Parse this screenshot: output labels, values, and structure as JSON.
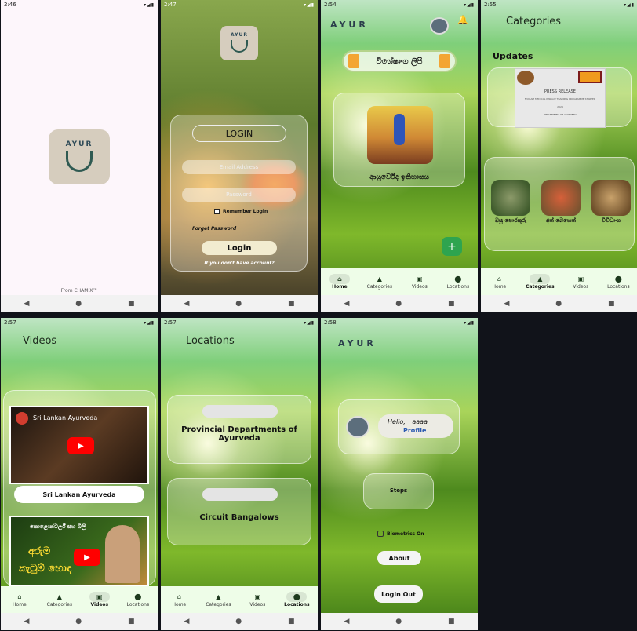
{
  "screens": {
    "splash": {
      "time": "2:46",
      "logo_text": "AYUR",
      "footer": "From CHAMIX™"
    },
    "login": {
      "time": "2:47",
      "logo_text": "AYUR",
      "title": "LOGIN",
      "email_placeholder": "Email Address",
      "password_placeholder": "Password",
      "remember": "Remember Login",
      "forgot": "Forget Password",
      "login_button": "Login",
      "signup": "If you don't have account?"
    },
    "home": {
      "time": "2:54",
      "logo_text": "AYUR",
      "special_label": "විශේෂාංග ලිපි",
      "card_title": "ආයුර්වේද ඉතිහාසය",
      "fab": "+"
    },
    "categories": {
      "time": "2:55",
      "title": "Categories",
      "updates": "Updates",
      "press_title": "PRESS RELEASE",
      "press_sub": "NVIGAM MEDICAL INSIGUE TRAINING PROGRAMME STARTED",
      "press_year": "2024",
      "press_dept": "DEPARTMENT OF AYURVEDA",
      "items": [
        "ඔසු පොරකුරු",
        "අත් බෙහෙත්",
        "විවිධාංග"
      ]
    },
    "videos": {
      "time": "2:57",
      "title": "Videos",
      "v1_channel": "Sri Lankan Ayurveda",
      "v1_button": "Sri Lankan Ayurveda",
      "v2_text1": "කොළොන්ටර්ල් සහ බිලි",
      "v2_text2": "අරුම",
      "v2_text3": "කැටුම් හොඳ"
    },
    "locations": {
      "time": "2:57",
      "title": "Locations",
      "card1": "Provincial Departments of Ayurveda",
      "card2": "Circuit Bangalows"
    },
    "profile": {
      "time": "2:58",
      "logo_text": "AYUR",
      "hello": "Hello,",
      "user": "aaaa",
      "profile": "Profile",
      "steps": "Steps",
      "biometrics": "Biometrics On",
      "about": "About",
      "logout": "Login Out"
    }
  },
  "nav": {
    "home": "Home",
    "categories": "Categories",
    "videos": "Videos",
    "locations": "Locations"
  },
  "colors": {
    "accent": "#2ea44f",
    "nav_bg": "#eefde8"
  }
}
